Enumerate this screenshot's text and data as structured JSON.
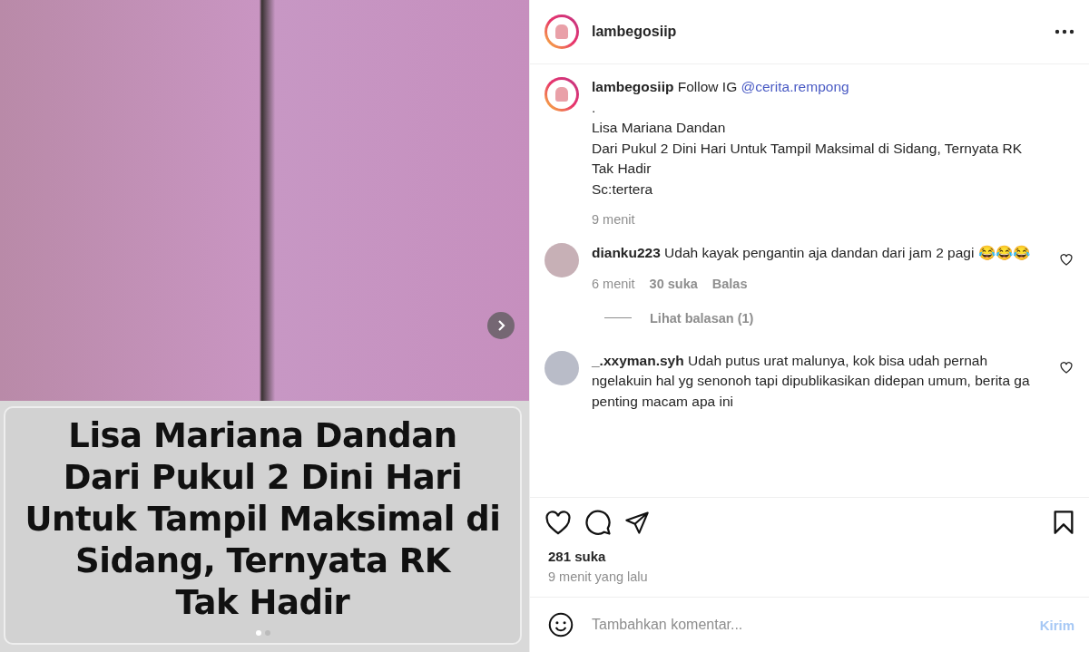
{
  "media": {
    "slide_caption": [
      "Lisa Mariana Dandan",
      "Dari Pukul 2 Dini Hari",
      "Untuk Tampil Maksimal di",
      "Sidang, Ternyata RK",
      "Tak Hadir"
    ],
    "dots": [
      {
        "selected": true
      },
      {
        "selected": false
      }
    ]
  },
  "header": {
    "username": "lambegosiip"
  },
  "caption": {
    "intro": "**lambegosiip** Follow IG ",
    "mention": "@cerita.rempong",
    "lines": [
      ".",
      "Lisa Mariana Dandan",
      "Dari Pukul 2 Dini Hari Untuk Tampil Maksimal di Sidang, Ternyata RK Tak Hadir",
      "Sc:tertera"
    ],
    "time": "9 menit"
  },
  "comments": [
    {
      "text": "**dianku223** Udah kayak pengantin aja dandan dari jam 2 pagi 😂😂😂",
      "time": "6 menit",
      "likes": "30 suka",
      "reply": "Balas",
      "view_replies": "Lihat balasan (1)"
    },
    {
      "text": "**_.xxyman.syh** Udah putus urat malunya, kok bisa udah pernah ngelakuin hal yg senonoh tapi dipublikasikan didepan umum, berita ga penting macam apa ini"
    }
  ],
  "likes": "281 suka",
  "posted": "9 menit yang lalu",
  "comment_box": {
    "placeholder": "Tambahkan komentar...",
    "submit": "Kirim"
  }
}
